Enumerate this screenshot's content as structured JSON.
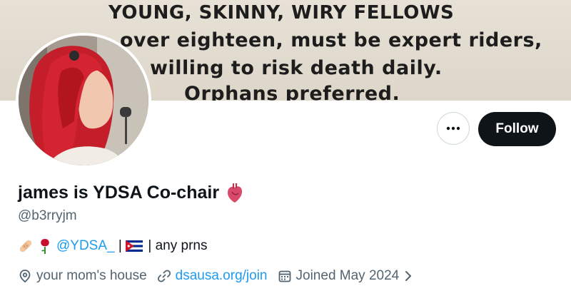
{
  "banner": {
    "lines": [
      "YOUNG, SKINNY, WIRY FELLOWS",
      "over eighteen, must be expert riders,",
      "willing to risk death daily.",
      "Orphans preferred."
    ]
  },
  "profile": {
    "display_name": "james is YDSA Co-chair",
    "name_emoji_icon": "anatomical-heart-icon",
    "handle": "@b3rryjm",
    "bio": {
      "emoji_1": "bandage-icon",
      "emoji_2": "rose-icon",
      "mention": "@YDSA_",
      "sep1": " | ",
      "flag": "cuba-flag-icon",
      "sep2": " | any prns"
    },
    "location": "your mom's house",
    "website": "dsausa.org/join",
    "joined": "Joined May 2024"
  },
  "actions": {
    "more_icon": "ellipsis-icon",
    "follow_label": "Follow"
  },
  "colors": {
    "link": "#1d9bf0",
    "secondary_text": "#536471",
    "follow_bg": "#0f1419"
  }
}
